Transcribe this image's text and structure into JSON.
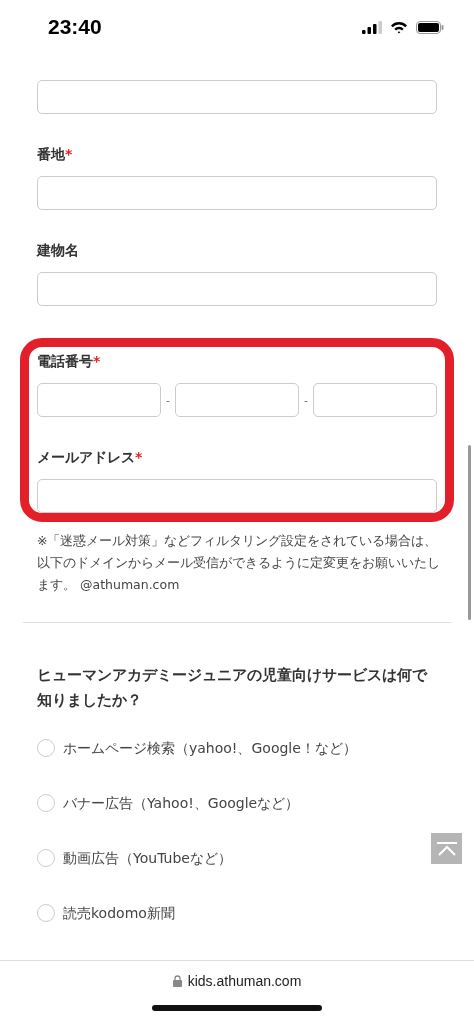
{
  "status_bar": {
    "time": "23:40"
  },
  "fields": [
    {
      "kind": "text",
      "highlighted": false
    },
    {
      "kind": "text",
      "label": "番地",
      "mark": "*",
      "highlighted": false
    },
    {
      "kind": "text",
      "label": "建物名",
      "highlighted": false
    },
    {
      "kind": "phone",
      "label": "電話番号",
      "mark": "*",
      "separators": [
        "-",
        "-"
      ],
      "highlighted": true
    },
    {
      "kind": "text",
      "label": "メールアドレス",
      "mark": "*",
      "highlighted": true
    }
  ],
  "notice": "※「迷惑メール対策」などフィルタリング設定をされている場合は、以下のドメインからメール受信ができるように定変更をお願いいたします。 @athuman.com",
  "question": {
    "title": "ヒューマンアカデミージュニアの児童向けサービスは何で知りましたか？",
    "options": [
      {
        "label": "ホームページ検索（yahoo!、Google！など）",
        "selected": false
      },
      {
        "label": "バナー広告（Yahoo!、Googleなど）",
        "selected": false
      },
      {
        "label": "動画広告（YouTubeなど）",
        "selected": false
      },
      {
        "label": "読売kodomo新聞",
        "selected": false
      }
    ]
  },
  "browser_bar": {
    "url": "kids.athuman.com"
  }
}
